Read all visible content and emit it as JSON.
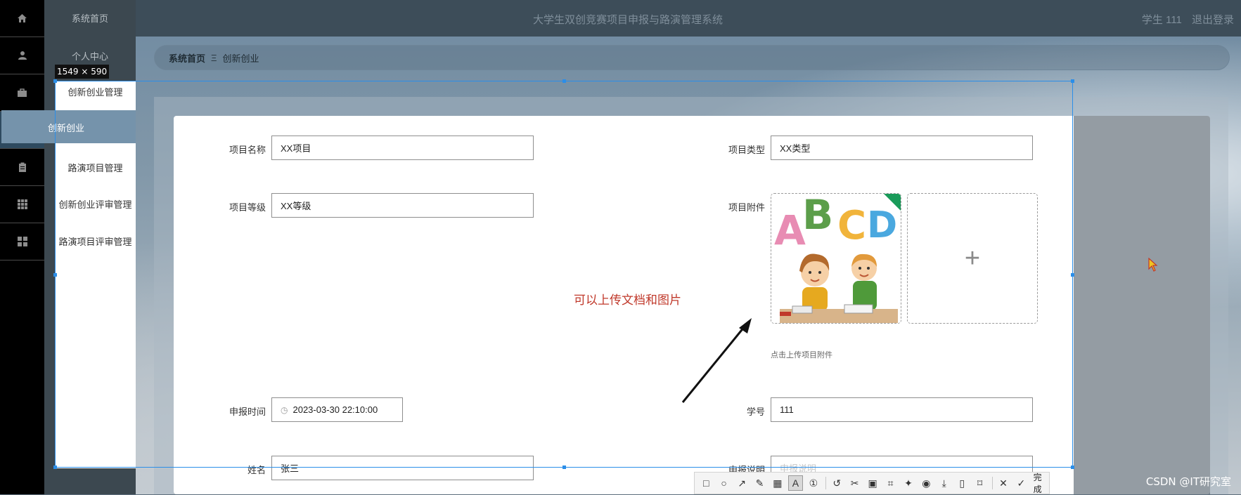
{
  "header": {
    "title": "大学生双创竞赛项目申报与路演管理系统",
    "user": "学生 111",
    "logout": "退出登录"
  },
  "menu": {
    "items": [
      "系统首页",
      "个人中心",
      "创新创业管理",
      "创新创业",
      "路演项目管理",
      "创新创业评审管理",
      "路演项目评审管理"
    ]
  },
  "rail_icons": [
    "home-icon",
    "user-icon",
    "briefcase-icon",
    "clipboard-icon",
    "grid-icon",
    "apps-icon"
  ],
  "breadcrumb": {
    "home": "系统首页",
    "separator": "Ξ",
    "current": "创新创业"
  },
  "form": {
    "project_name": {
      "label": "项目名称",
      "value": "XX项目"
    },
    "project_type": {
      "label": "项目类型",
      "value": "XX类型"
    },
    "project_level": {
      "label": "项目等级",
      "value": "XX等级"
    },
    "project_attachment": {
      "label": "项目附件",
      "tip": "点击上传项目附件"
    },
    "submit_time": {
      "label": "申报时间",
      "value": "2023-03-30 22:10:00"
    },
    "student_id": {
      "label": "学号",
      "value": "111"
    },
    "name": {
      "label": "姓名",
      "value": "张三"
    },
    "description": {
      "label": "申报说明",
      "placeholder": "申报说明"
    }
  },
  "annotation": "可以上传文档和图片",
  "screenshot_tool": {
    "size": "1549 × 590",
    "done": "完成",
    "accent": "#2b8ee8"
  },
  "watermark": "CSDN @IT研究室",
  "colors": {
    "annotation": "#c0392b",
    "active_menu": "#7593ab"
  }
}
